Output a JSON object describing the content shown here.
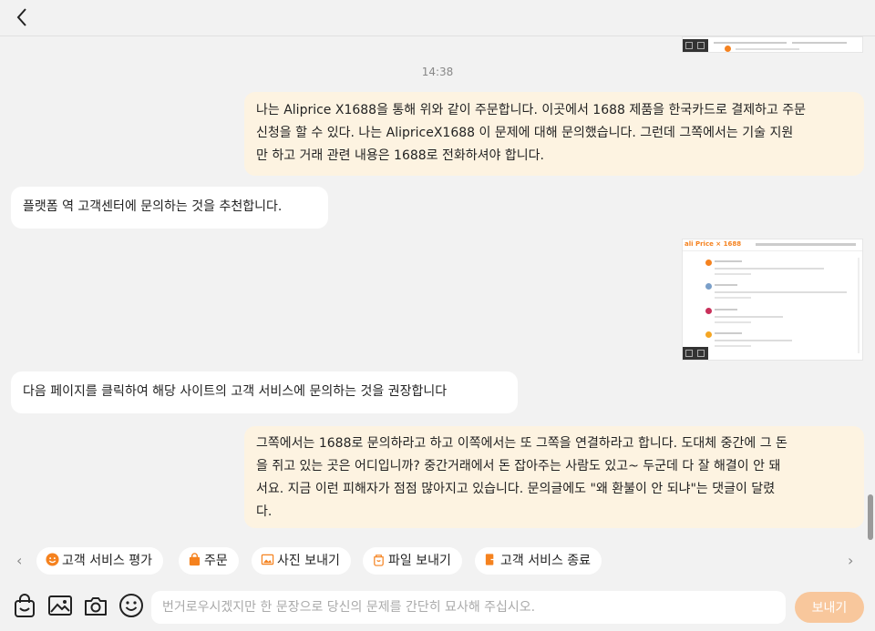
{
  "header": {
    "back_icon": "chevron-left-icon"
  },
  "messages": {
    "timestamp": "14:38",
    "user_1": [
      "나는 Aliprice X1688을 통해 위와 같이 주문합니다. 이곳에서 1688 제품을 한국카드로 결제하고 주문",
      "신청을 할 수 있다. 나는 AlipriceX1688 이 문제에 대해 문의했습니다. 그런데 그쪽에서는 기술 지원",
      "만 하고 거래 관련 내용은 1688로 전화하셔야 합니다."
    ],
    "agent_1": "플랫폼 역 고객센터에 문의하는 것을 추천합니다.",
    "screenshot_logo": "ali Price × 1688",
    "agent_2": "다음 페이지를 클릭하여 해당 사이트의 고객 서비스에 문의하는 것을 권장합니다",
    "user_2": [
      "그쪽에서는 1688로 문의하라고 하고 이쪽에서는 또 그쪽을 연결하라고 합니다. 도대체 중간에 그 돈",
      "을 쥐고 있는 곳은 어디입니까? 중간거래에서 돈 잡아주는 사람도 있고~ 두군데 다 잘 해결이 안 돼",
      "서요. 지금 이런 피해자가 점점 많아지고 있습니다. 문의글에도 \"왜 환불이 안 되냐\"는 댓글이 달렸",
      "다."
    ]
  },
  "quick_actions": [
    {
      "label": "고객 서비스 평가",
      "icon": "smiley-icon"
    },
    {
      "label": "주문",
      "icon": "shopping-bag-icon"
    },
    {
      "label": "사진 보내기",
      "icon": "image-icon"
    },
    {
      "label": "파일 보내기",
      "icon": "file-icon"
    },
    {
      "label": "고객 서비스 종료",
      "icon": "exit-icon"
    }
  ],
  "composer": {
    "placeholder": "번거로우시겠지만 한 문장으로 당신의 문제를 간단히 묘사해 주십시오.",
    "send_label": "보내기"
  },
  "colors": {
    "accent": "#f5821f",
    "user_bubble": "#fdf3e1",
    "send_button": "#f8c79c"
  }
}
